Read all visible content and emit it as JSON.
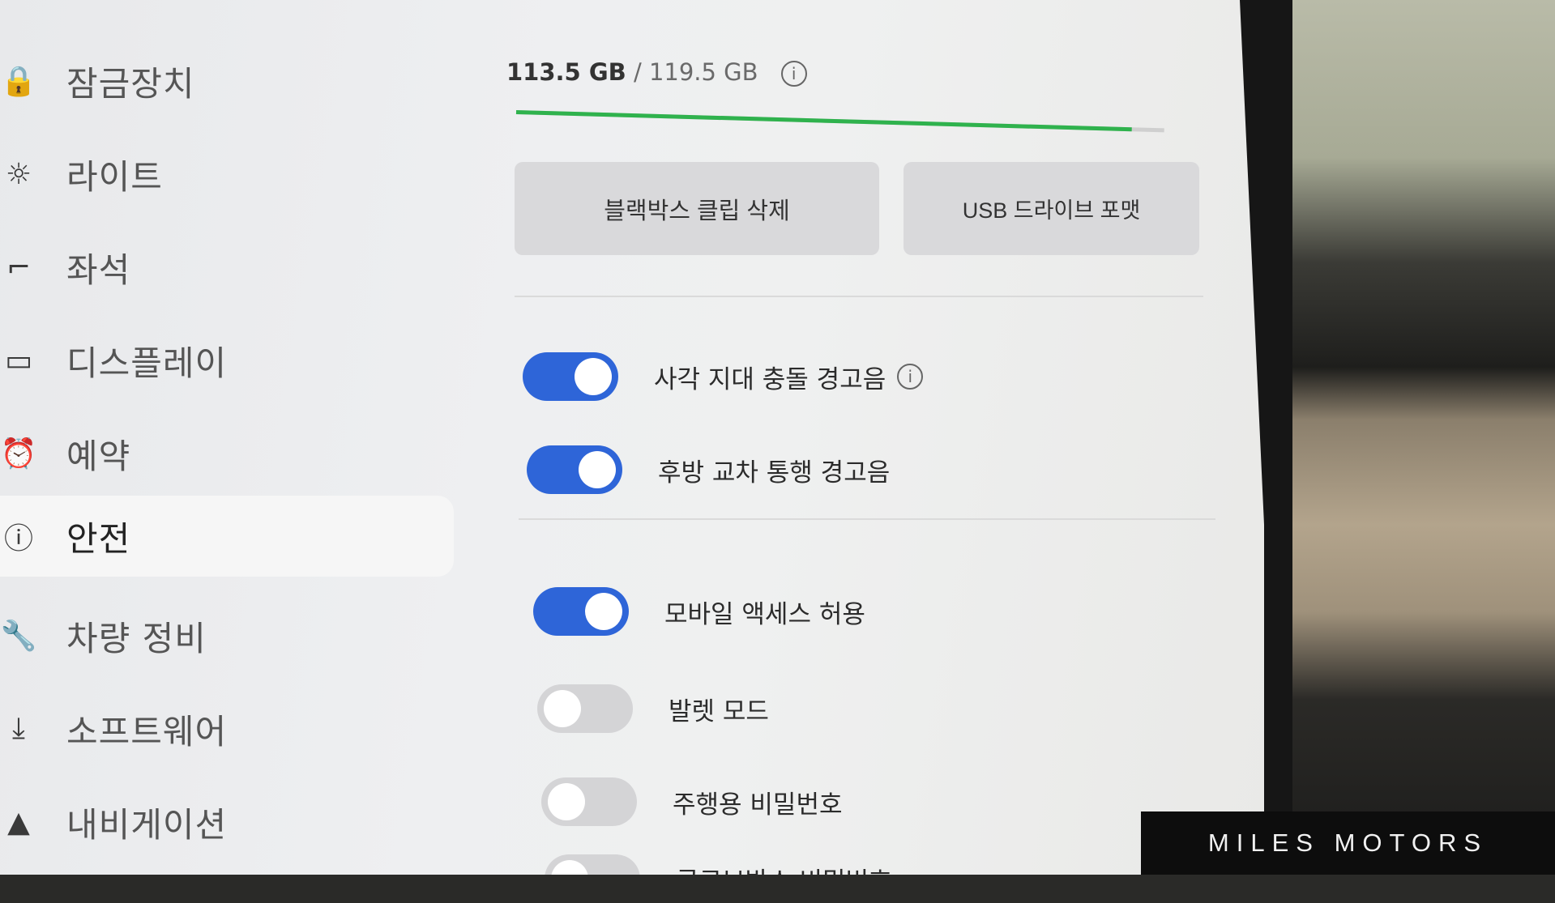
{
  "sidebar": {
    "items": [
      {
        "label": "잠금장치",
        "icon": "lock-icon",
        "glyph": "🔒"
      },
      {
        "label": "라이트",
        "icon": "light-icon",
        "glyph": "☼"
      },
      {
        "label": "좌석",
        "icon": "seat-icon",
        "glyph": "⌐"
      },
      {
        "label": "디스플레이",
        "icon": "display-icon",
        "glyph": "▭"
      },
      {
        "label": "예약",
        "icon": "schedule-icon",
        "glyph": "⏰"
      },
      {
        "label": "안전",
        "icon": "safety-icon",
        "glyph": "ⓘ"
      },
      {
        "label": "차량 정비",
        "icon": "wrench-icon",
        "glyph": "🔧"
      },
      {
        "label": "소프트웨어",
        "icon": "download-icon",
        "glyph": "⤓"
      },
      {
        "label": "내비게이션",
        "icon": "navigation-icon",
        "glyph": "▲"
      }
    ],
    "active": "안전"
  },
  "storage": {
    "used": "113.5 GB",
    "total": " / 119.5 GB",
    "used_fraction": 0.95,
    "bar_color": "#2fb24d"
  },
  "buttons": {
    "delete_clips": "블랙박스 클립 삭제",
    "format_usb": "USB 드라이브 포맷"
  },
  "toggles": [
    {
      "label": "사각 지대 충돌 경고음",
      "on": true,
      "info": true
    },
    {
      "label": "후방 교차 통행 경고음",
      "on": true,
      "info": false
    },
    {
      "label": "모바일 액세스 허용",
      "on": true,
      "info": false
    },
    {
      "label": "발렛 모드",
      "on": false,
      "info": false
    },
    {
      "label": "주행용 비밀번호",
      "on": false,
      "info": false
    },
    {
      "label": "글로브박스 비밀번호",
      "on": false,
      "info": false
    }
  ],
  "info_glyph": "i",
  "accent_color": "#2e65d8",
  "watermark": "MILES MOTORS"
}
